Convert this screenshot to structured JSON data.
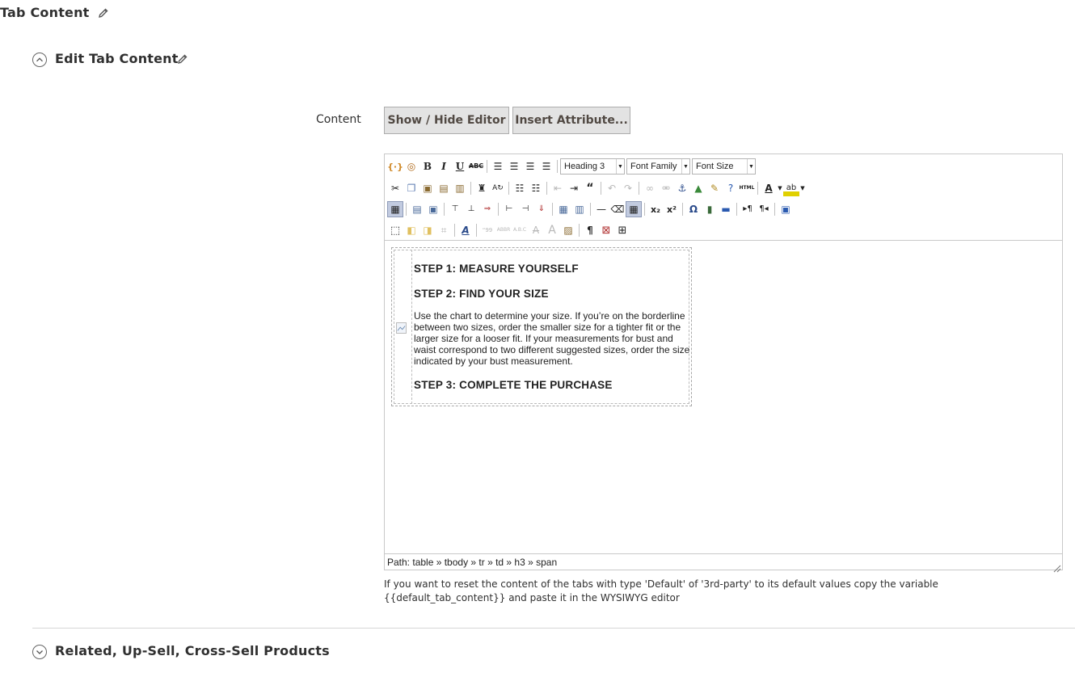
{
  "header": {
    "title": "Tab Content"
  },
  "edit_section": {
    "title": "Edit Tab Content"
  },
  "content_field": {
    "label": "Content",
    "buttons": {
      "show_hide": "Show / Hide Editor",
      "insert_attribute": "Insert Attribute..."
    }
  },
  "editor": {
    "selects": {
      "format": "Heading 3",
      "font_family": "Font Family",
      "font_size": "Font Size"
    },
    "toolbar_icons": {
      "row1": [
        "widget-icon",
        "image-icon",
        "bold-icon",
        "italic-icon",
        "underline-icon",
        "strikethrough-icon",
        "align-left-icon",
        "align-center-icon",
        "align-right-icon",
        "align-justify-icon"
      ],
      "row2": [
        "cut-icon",
        "copy-icon",
        "paste-icon",
        "paste-text-icon",
        "paste-word-icon",
        "find-icon",
        "replace-icon",
        "bullet-list-icon",
        "numbered-list-icon",
        "outdent-icon",
        "indent-icon",
        "blockquote-icon",
        "undo-icon",
        "redo-icon",
        "link-icon",
        "unlink-icon",
        "anchor-icon",
        "insert-image-icon",
        "cleanup-icon",
        "help-icon",
        "html-icon",
        "text-color-icon",
        "background-color-icon"
      ],
      "row3": [
        "table-icon",
        "row-props-icon",
        "cell-props-icon",
        "insert-row-before-icon",
        "insert-row-after-icon",
        "delete-row-icon",
        "insert-col-before-icon",
        "insert-col-after-icon",
        "delete-col-icon",
        "split-cells-icon",
        "merge-cells-icon",
        "hr-icon",
        "remove-format-icon",
        "visual-aid-icon",
        "subscript-icon",
        "superscript-icon",
        "charmap-icon",
        "media-icon",
        "advhr-icon",
        "ltr-icon",
        "rtl-icon",
        "fullscreen-icon"
      ],
      "row4": [
        "insert-layer-icon",
        "move-forward-icon",
        "move-backward-icon",
        "absolute-icon",
        "styleprops-icon",
        "cite-icon",
        "abbr-icon",
        "acronym-icon",
        "del-icon",
        "ins-icon",
        "attribs-icon",
        "visualchars-icon",
        "nonbreaking-icon",
        "pagebreak-icon"
      ]
    },
    "content": {
      "step1": "STEP 1: MEASURE YOURSELF",
      "step2": "STEP 2: FIND YOUR SIZE",
      "paragraph": "Use the chart  to determine your size. If you’re on the borderline between two sizes, order the smaller size for a tighter fit or the larger size for a looser fit. If your measurements for bust and waist correspond to two different suggested sizes, order the size indicated by your bust measurement.",
      "step3": "STEP 3: COMPLETE THE PURCHASE"
    },
    "path": "Path: table » tbody » tr » td » h3 » span"
  },
  "note": "If you want to reset the content of the tabs with type 'Default' of '3rd-party' to its default values copy the variable {{default_tab_content}} and paste it in the WYSIWYG editor",
  "related_section": {
    "title": "Related, Up-Sell, Cross-Sell Products"
  },
  "colors": {
    "button_bg": "#e3e3e3",
    "border": "#c9c9c9",
    "text": "#303030"
  }
}
